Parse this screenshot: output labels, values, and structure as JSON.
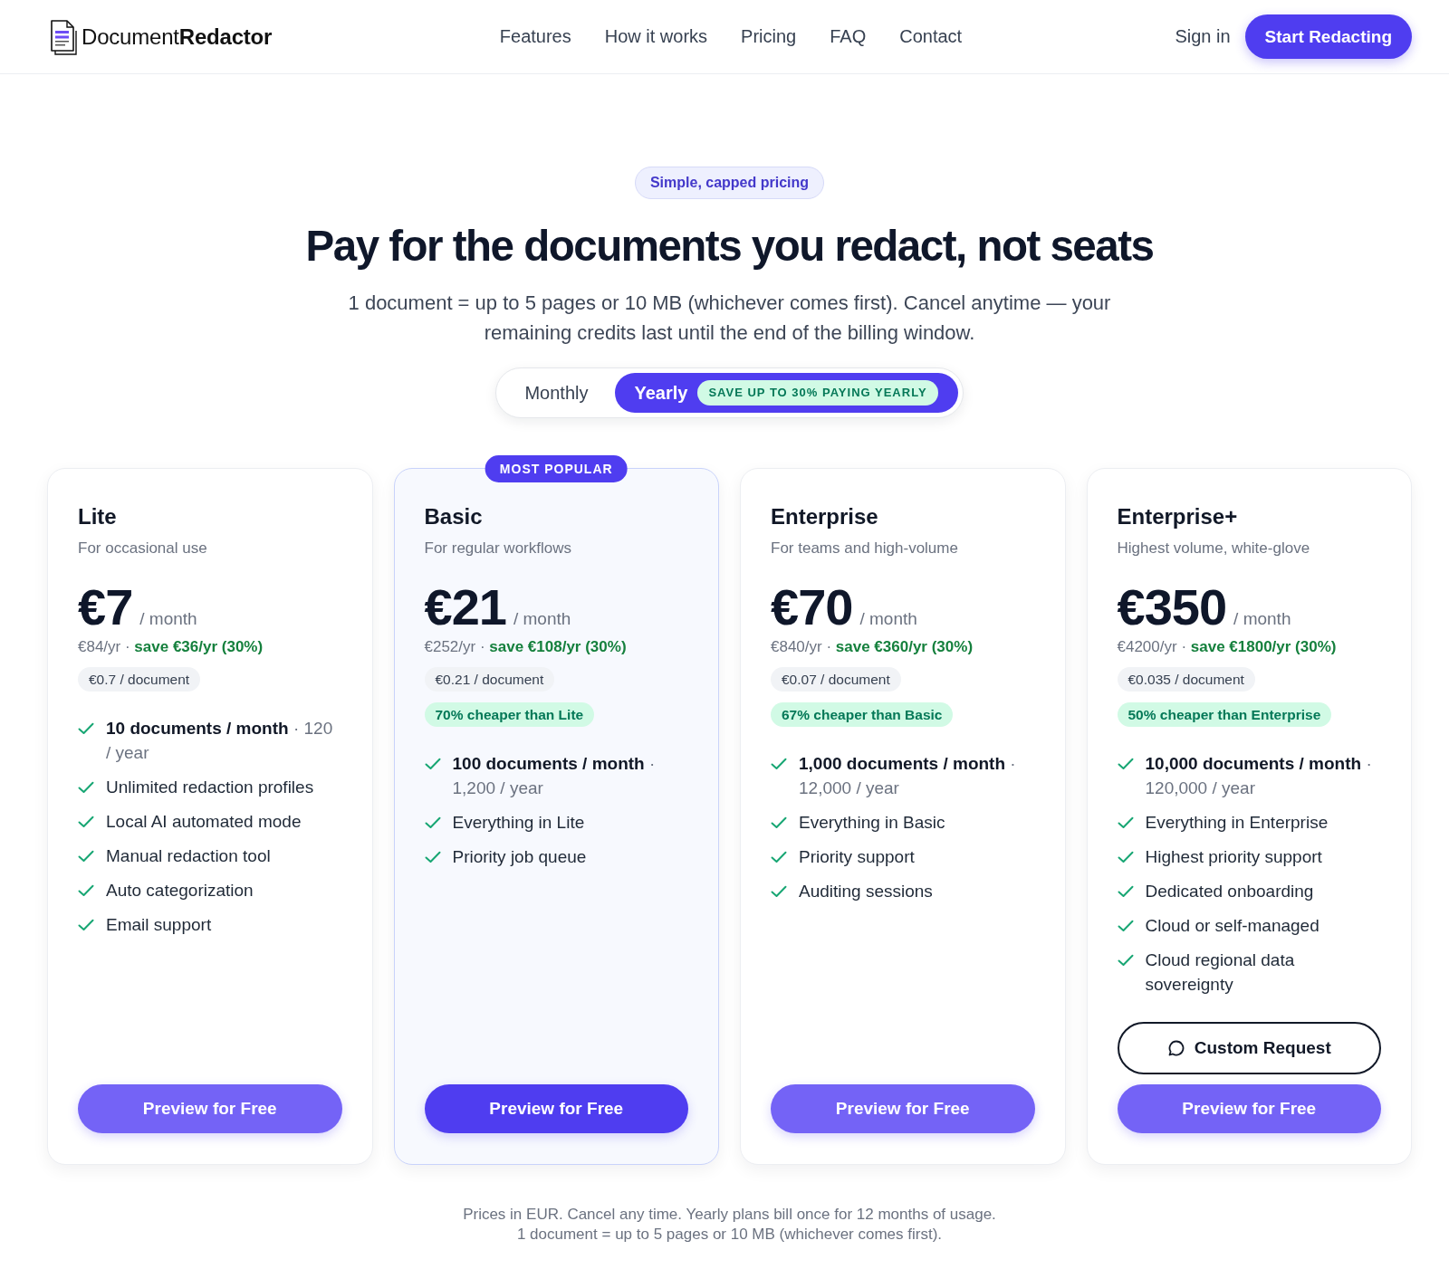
{
  "header": {
    "logo_text": "Document**Redactor**",
    "nav": [
      {
        "label": "Features"
      },
      {
        "label": "How it works"
      },
      {
        "label": "Pricing"
      },
      {
        "label": "FAQ"
      },
      {
        "label": "Contact"
      }
    ],
    "sign_in": "Sign in",
    "cta": "Start Redacting"
  },
  "hero": {
    "badge": "Simple, capped pricing",
    "title": "Pay for the documents you redact, not seats",
    "subtitle": "1 document = up to 5 pages or 10 MB (whichever comes first). Cancel anytime — your remaining credits last until the end of the billing window."
  },
  "billing_toggle": {
    "options": [
      {
        "label": "Monthly",
        "selected": false
      },
      {
        "label": "Yearly",
        "selected": true,
        "badge": "SAVE UP TO 30% PAYING YEARLY"
      }
    ]
  },
  "plans": [
    {
      "name": "Lite",
      "featured": false,
      "tagline": "For occasional use",
      "price": "€7",
      "period": "/ month",
      "yearly": "€84/yr · **save €36/yr (30%)**",
      "per_document": "€0.7 / document",
      "features": [
        {
          "kind": "quota",
          "text": "**10 documents / month** · 120 / year"
        },
        {
          "kind": "plain",
          "text": "Unlimited redaction profiles"
        },
        {
          "kind": "plain",
          "text": "Local AI automated mode"
        },
        {
          "kind": "plain",
          "text": "Manual redaction tool"
        },
        {
          "kind": "plain",
          "text": "Auto categorization"
        },
        {
          "kind": "plain",
          "text": "Email support"
        }
      ],
      "actions": [
        {
          "kind": "primary",
          "label": "Preview for Free"
        }
      ]
    },
    {
      "name": "Basic",
      "featured": true,
      "ribbon": "MOST POPULAR",
      "tagline": "For regular workflows",
      "price": "€21",
      "period": "/ month",
      "yearly": "€252/yr · **save €108/yr (30%)**",
      "per_document": "€0.21 / document",
      "comparison": "70% cheaper than Lite",
      "features": [
        {
          "kind": "quota",
          "text": "**100 documents / month** · 1,200 / year"
        },
        {
          "kind": "plain",
          "text": "Everything in Lite"
        },
        {
          "kind": "plain",
          "text": "Priority job queue"
        }
      ],
      "actions": [
        {
          "kind": "primary",
          "label": "Preview for Free"
        }
      ]
    },
    {
      "name": "Enterprise",
      "featured": false,
      "tagline": "For teams and high-volume",
      "price": "€70",
      "period": "/ month",
      "yearly": "€840/yr · **save €360/yr (30%)**",
      "per_document": "€0.07 / document",
      "comparison": "67% cheaper than Basic",
      "features": [
        {
          "kind": "quota",
          "text": "**1,000 documents / month** · 12,000 / year"
        },
        {
          "kind": "plain",
          "text": "Everything in Basic"
        },
        {
          "kind": "plain",
          "text": "Priority support"
        },
        {
          "kind": "plain",
          "text": "Auditing sessions"
        }
      ],
      "actions": [
        {
          "kind": "primary",
          "label": "Preview for Free"
        }
      ]
    },
    {
      "name": "Enterprise+",
      "featured": false,
      "tagline": "Highest volume, white-glove",
      "price": "€350",
      "period": "/ month",
      "yearly": "€4200/yr · **save €1800/yr (30%)**",
      "per_document": "€0.035 / document",
      "comparison": "50% cheaper than Enterprise",
      "features": [
        {
          "kind": "quota",
          "text": "**10,000 documents / month** · 120,000 / year"
        },
        {
          "kind": "plain",
          "text": "Everything in Enterprise"
        },
        {
          "kind": "plain",
          "text": "Highest priority support"
        },
        {
          "kind": "plain",
          "text": "Dedicated onboarding"
        },
        {
          "kind": "plain",
          "text": "Cloud or self-managed"
        },
        {
          "kind": "plain",
          "text": "Cloud regional data sovereignty"
        }
      ],
      "actions": [
        {
          "kind": "outline",
          "label": "Custom Request"
        },
        {
          "kind": "primary",
          "label": "Preview for Free"
        }
      ]
    }
  ],
  "footer_note": [
    "Prices in EUR. Cancel any time. Yearly plans bill once for 12 months of usage.",
    "1 document = up to 5 pages or 10 MB (whichever comes first)."
  ]
}
